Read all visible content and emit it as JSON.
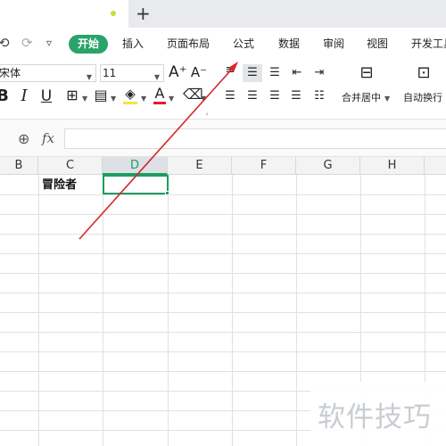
{
  "tabbar": {
    "new_tab": "+"
  },
  "menu": {
    "undo": "⟲",
    "redo": "⟳",
    "more": "▿",
    "items": [
      {
        "label": "开始",
        "active": true
      },
      {
        "label": "插入"
      },
      {
        "label": "页面布局"
      },
      {
        "label": "公式"
      },
      {
        "label": "数据"
      },
      {
        "label": "审阅"
      },
      {
        "label": "视图"
      },
      {
        "label": "开发工具"
      }
    ]
  },
  "toolbar": {
    "font_name": "宋体",
    "font_size": "11",
    "grow_font": "A⁺",
    "shrink_font": "A⁻",
    "bold": "B",
    "italic": "I",
    "underline": "U",
    "font_color_glyph": "A",
    "merge_center_label": "合并居中",
    "wrap_text_label": "自动换行"
  },
  "formula_bar": {
    "fx_label": "fx",
    "zoom_icon": "⊕"
  },
  "grid": {
    "columns": [
      "B",
      "C",
      "D",
      "E",
      "F",
      "G",
      "H"
    ],
    "active_column": "D",
    "cells": {
      "C2": "冒险者"
    }
  },
  "watermark": "软件技巧",
  "colors": {
    "accent": "#1e9c62",
    "menu_pill": "#29a36a",
    "annotation": "#d42a2a",
    "font_color_bar": "#e02020",
    "fill_color_bar": "#f5e342"
  }
}
